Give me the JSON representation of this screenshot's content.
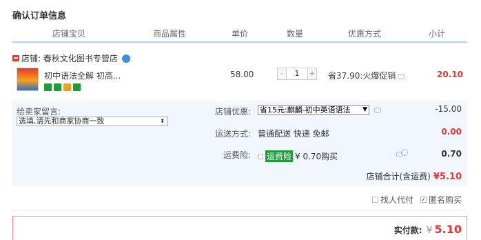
{
  "page_title": "确认订单信息",
  "columns": [
    "店铺宝贝",
    "商品属性",
    "单价",
    "数量",
    "优惠方式",
    "小计"
  ],
  "shop": {
    "label": "店铺: 春秋文化图书专营店"
  },
  "item": {
    "name": "初中语法全解 初高...",
    "price": "58.00",
    "quantity": "1",
    "qty_minus": "-",
    "qty_plus": "+",
    "promo": "省37.90:火爆促销",
    "subtotal": "20.10",
    "badge_colors": [
      "#1e9c3a",
      "#1e9c3a",
      "#f0a020",
      "#1e9c3a"
    ]
  },
  "message": {
    "label": "给卖家留言:",
    "value": "选填,请先和商家协商一致"
  },
  "shop_discount": {
    "label": "店铺优惠:",
    "selected": "省15元:麒麟-初中英语语法",
    "amount": "-15.00"
  },
  "shipping": {
    "label": "运送方式:",
    "method": "普通配送 快递 免邮",
    "amount": "0.00"
  },
  "insurance": {
    "label": "运费险:",
    "tag": "运费险",
    "text": "¥ 0.70购买",
    "amount": "0.70"
  },
  "shop_total": {
    "label": "店铺合计(含运费)",
    "value": "¥5.10"
  },
  "options": {
    "proxy_pay": "找人代付",
    "anonymous": "匿名购买"
  },
  "payment": {
    "label": "实付款:",
    "currency": "¥",
    "value": "5.10"
  }
}
